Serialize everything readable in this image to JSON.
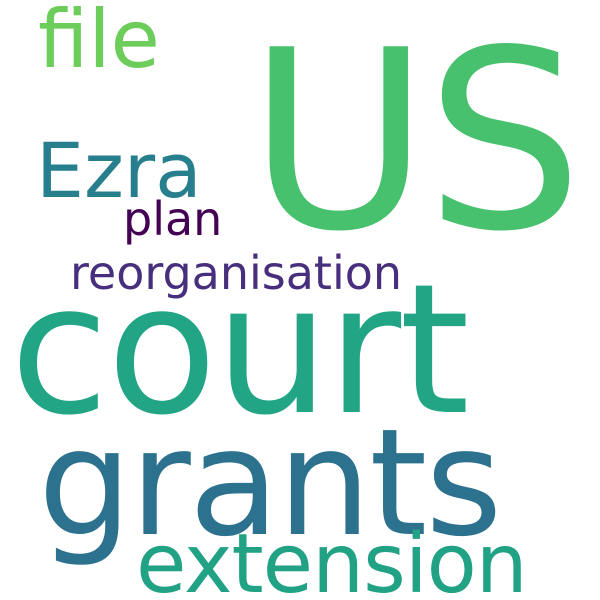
{
  "words": [
    {
      "text": "US",
      "color": "#48c16e"
    },
    {
      "text": "court",
      "color": "#21a585"
    },
    {
      "text": "grants",
      "color": "#2c728e"
    },
    {
      "text": "extension",
      "color": "#22a284"
    },
    {
      "text": "Ezra",
      "color": "#277f8e"
    },
    {
      "text": "file",
      "color": "#6ccd5a"
    },
    {
      "text": "plan",
      "color": "#440154"
    },
    {
      "text": "reorganisation",
      "color": "#472f7d"
    }
  ]
}
